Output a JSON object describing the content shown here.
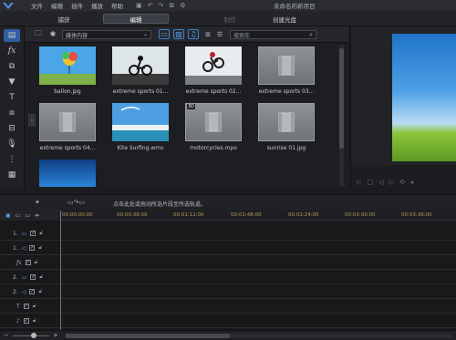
{
  "window": {
    "title": "未命名的新项目"
  },
  "menu": [
    "文件",
    "编辑",
    "插件",
    "播放",
    "帮助"
  ],
  "mode_tabs": [
    {
      "label": "捕获",
      "state": "normal"
    },
    {
      "label": "编辑",
      "state": "active"
    },
    {
      "label": "制作",
      "state": "disabled"
    },
    {
      "label": "创建光盘",
      "state": "normal"
    }
  ],
  "library": {
    "dropdown_value": "媒体内容",
    "search_placeholder": "搜索库",
    "items": [
      {
        "name": "ballon.jpg",
        "thumb": "balloon-photo"
      },
      {
        "name": "extreme sports 01...",
        "thumb": "bmx-photo"
      },
      {
        "name": "extreme sports 02...",
        "thumb": "motocross-photo"
      },
      {
        "name": "extreme sports 03...",
        "thumb": "video-placeholder"
      },
      {
        "name": "extreme sports 04...",
        "thumb": "video-placeholder"
      },
      {
        "name": "Kite Surfing.wmv",
        "thumb": "kite-photo"
      },
      {
        "name": "motorcycles.mpo",
        "thumb": "video-placeholder",
        "badge": "3D"
      },
      {
        "name": "sunrise 01.jpg",
        "thumb": "video-placeholder"
      },
      {
        "name": "",
        "thumb": "blue-photo"
      }
    ]
  },
  "timeline": {
    "hint": "点击此处或拖动所选片段至所选轨道。",
    "timecodes": [
      "00:00:00:00",
      "00:00:38:00",
      "00:01:12:00",
      "00:01:48:00",
      "00:02:24:00",
      "00:03:00:00",
      "00:03:36:00"
    ],
    "tracks": [
      {
        "label": "1.",
        "icon": "video-track-icon"
      },
      {
        "label": "1.",
        "icon": "audio-track-icon"
      },
      {
        "label": "",
        "icon": "fx-track-icon"
      },
      {
        "label": "2.",
        "icon": "video-track-icon"
      },
      {
        "label": "2.",
        "icon": "audio-track-icon"
      },
      {
        "label": "",
        "icon": "title-track-icon"
      },
      {
        "label": "",
        "icon": "voice-track-icon"
      }
    ]
  },
  "colors": {
    "accent": "#3c82d6",
    "background": "#1b1c1f"
  }
}
